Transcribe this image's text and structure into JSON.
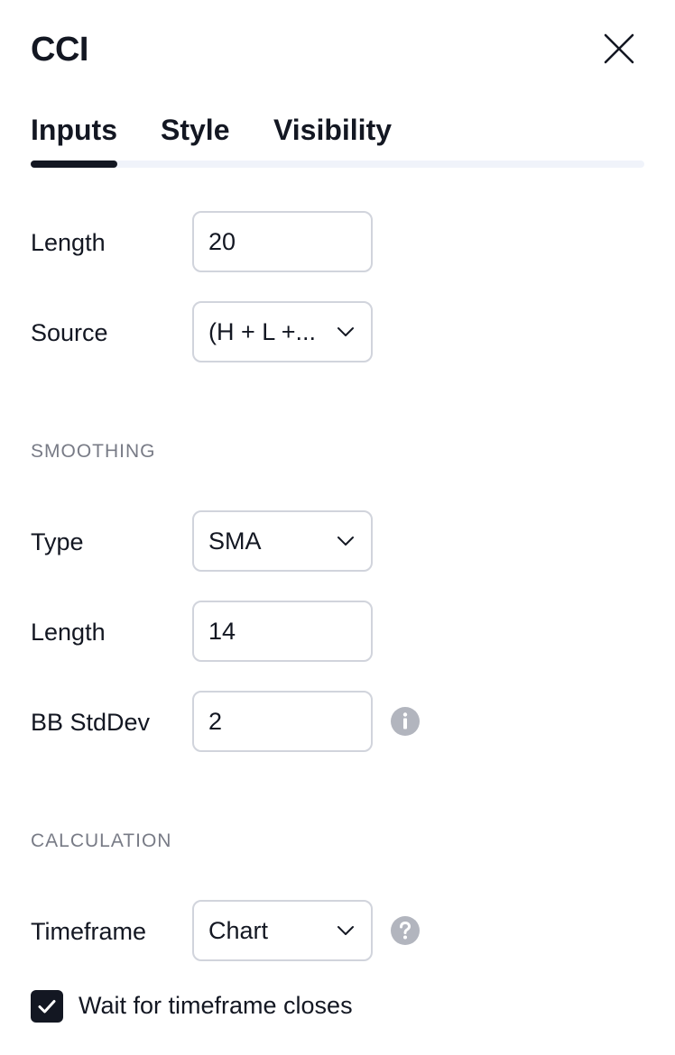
{
  "dialog": {
    "title": "CCI"
  },
  "tabs": [
    {
      "label": "Inputs",
      "active": true
    },
    {
      "label": "Style",
      "active": false
    },
    {
      "label": "Visibility",
      "active": false
    }
  ],
  "inputs": {
    "length": {
      "label": "Length",
      "value": "20"
    },
    "source": {
      "label": "Source",
      "value": "(H + L +..."
    }
  },
  "smoothing": {
    "section_title": "SMOOTHING",
    "type": {
      "label": "Type",
      "value": "SMA"
    },
    "length": {
      "label": "Length",
      "value": "14"
    },
    "bb_stddev": {
      "label": "BB StdDev",
      "value": "2"
    }
  },
  "calculation": {
    "section_title": "CALCULATION",
    "timeframe": {
      "label": "Timeframe",
      "value": "Chart"
    },
    "wait_for_close": {
      "label": "Wait for timeframe closes",
      "checked": true
    }
  },
  "colors": {
    "text": "#131722",
    "muted": "#787b86",
    "border": "#d1d4dc",
    "track": "#f0f3fa",
    "icon_gray": "#b2b5be"
  },
  "icons": {
    "close": "close-icon",
    "chevron": "chevron-down-icon",
    "info": "info-icon",
    "help": "help-icon",
    "check": "check-icon"
  }
}
